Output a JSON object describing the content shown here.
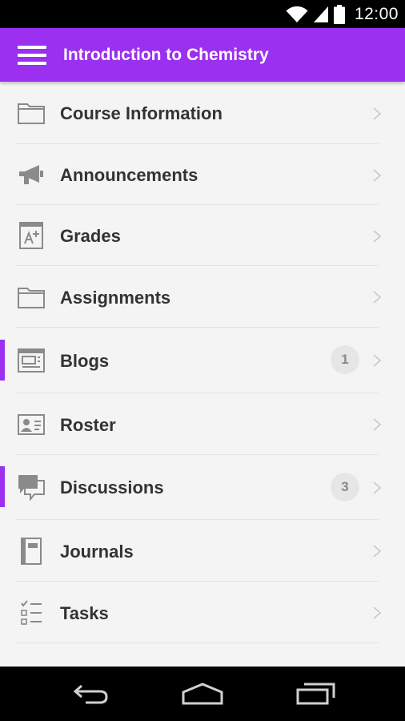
{
  "status_bar": {
    "time": "12:00"
  },
  "app_bar": {
    "title": "Introduction to Chemistry"
  },
  "menu": {
    "items": [
      {
        "label": "Course Information",
        "icon": "folder-icon",
        "badge": "",
        "active": false
      },
      {
        "label": "Announcements",
        "icon": "megaphone-icon",
        "badge": "",
        "active": false
      },
      {
        "label": "Grades",
        "icon": "grades-icon",
        "badge": "",
        "active": false
      },
      {
        "label": "Assignments",
        "icon": "folder-icon",
        "badge": "",
        "active": false
      },
      {
        "label": "Blogs",
        "icon": "blog-icon",
        "badge": "1",
        "active": true
      },
      {
        "label": "Roster",
        "icon": "roster-card-icon",
        "badge": "",
        "active": false
      },
      {
        "label": "Discussions",
        "icon": "discussion-bubbles-icon",
        "badge": "3",
        "active": true
      },
      {
        "label": "Journals",
        "icon": "journal-icon",
        "badge": "",
        "active": false
      },
      {
        "label": "Tasks",
        "icon": "tasks-checklist-icon",
        "badge": "",
        "active": false
      }
    ]
  },
  "colors": {
    "accent": "#9b30f0",
    "icon_gray": "#8a8a8a",
    "label": "#333333",
    "badge_bg": "#e6e6e6",
    "list_bg": "#f4f4f4"
  },
  "nav_bar": {
    "back": "back-icon",
    "home": "home-icon",
    "recents": "recent-apps-icon"
  }
}
